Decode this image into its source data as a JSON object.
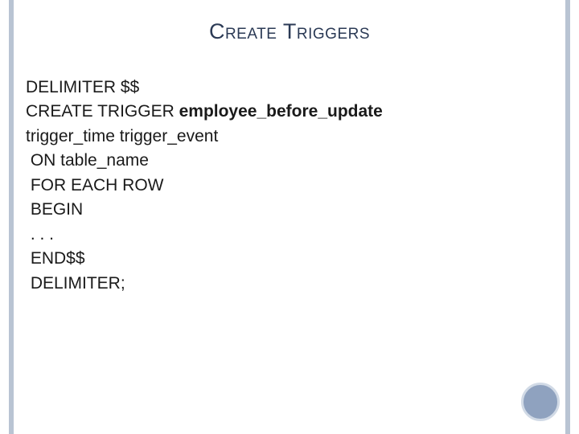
{
  "title": "Create Triggers",
  "code": {
    "l1": "DELIMITER $$",
    "l2a": "CREATE TRIGGER ",
    "l2b": "employee_before_update",
    "l3": "trigger_time trigger_event",
    "l4": " ON table_name",
    "l5": " FOR EACH ROW",
    "l6": " BEGIN",
    "l7": " . . .",
    "l8": " END$$",
    "l9": " DELIMITER;"
  }
}
